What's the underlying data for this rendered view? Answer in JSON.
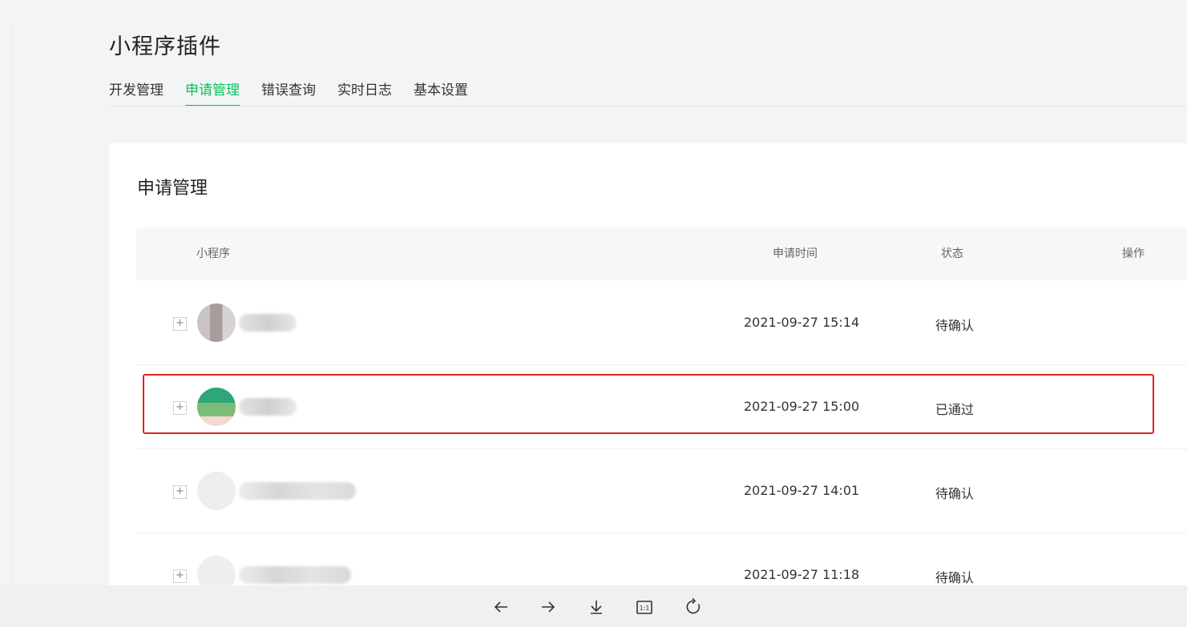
{
  "page": {
    "title": "小程序插件"
  },
  "tabs": [
    {
      "label": "开发管理",
      "active": false
    },
    {
      "label": "申请管理",
      "active": true
    },
    {
      "label": "错误查询",
      "active": false
    },
    {
      "label": "实时日志",
      "active": false
    },
    {
      "label": "基本设置",
      "active": false
    }
  ],
  "card": {
    "title": "申请管理",
    "headers": {
      "app": "小程序",
      "time": "申请时间",
      "status": "状态",
      "action": "操作"
    },
    "rows": [
      {
        "time": "2021-09-27 15:14",
        "status": "待确认"
      },
      {
        "time": "2021-09-27 15:00",
        "status": "已通过"
      },
      {
        "time": "2021-09-27 14:01",
        "status": "待确认"
      },
      {
        "time": "2021-09-27 11:18",
        "status": "待确认"
      }
    ]
  },
  "colors": {
    "accent": "#07c160",
    "highlight": "#e1231d"
  },
  "toolbar": {
    "icons": [
      "arrow-left-icon",
      "arrow-right-icon",
      "download-icon",
      "actual-size-icon",
      "rotate-icon"
    ],
    "actual_size_label": "1:1"
  }
}
